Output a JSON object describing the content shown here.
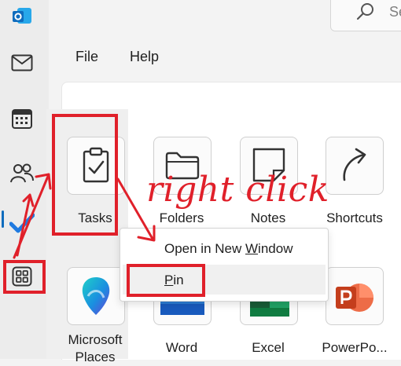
{
  "search": {
    "text": "Se"
  },
  "menu": {
    "file": "File",
    "help": "Help"
  },
  "rail": {
    "items": [
      {
        "name": "outlook-logo-icon"
      },
      {
        "name": "mail-icon"
      },
      {
        "name": "calendar-icon"
      },
      {
        "name": "people-icon"
      },
      {
        "name": "todo-check-icon"
      },
      {
        "name": "more-apps-icon"
      }
    ]
  },
  "apps": {
    "row1": [
      "Tasks",
      "Folders",
      "Notes",
      "Shortcuts"
    ],
    "row2": [
      "Microsoft Places",
      "Word",
      "Excel",
      "PowerPo..."
    ]
  },
  "context_menu": {
    "open_pre": "Open in New ",
    "open_accel": "W",
    "open_post": "indow",
    "pin_accel": "P",
    "pin_post": "in"
  },
  "annotation": {
    "text": "right click",
    "color": "#e0202a"
  },
  "colors": {
    "accent": "#0f6cbd",
    "annotation": "#e0202a"
  }
}
